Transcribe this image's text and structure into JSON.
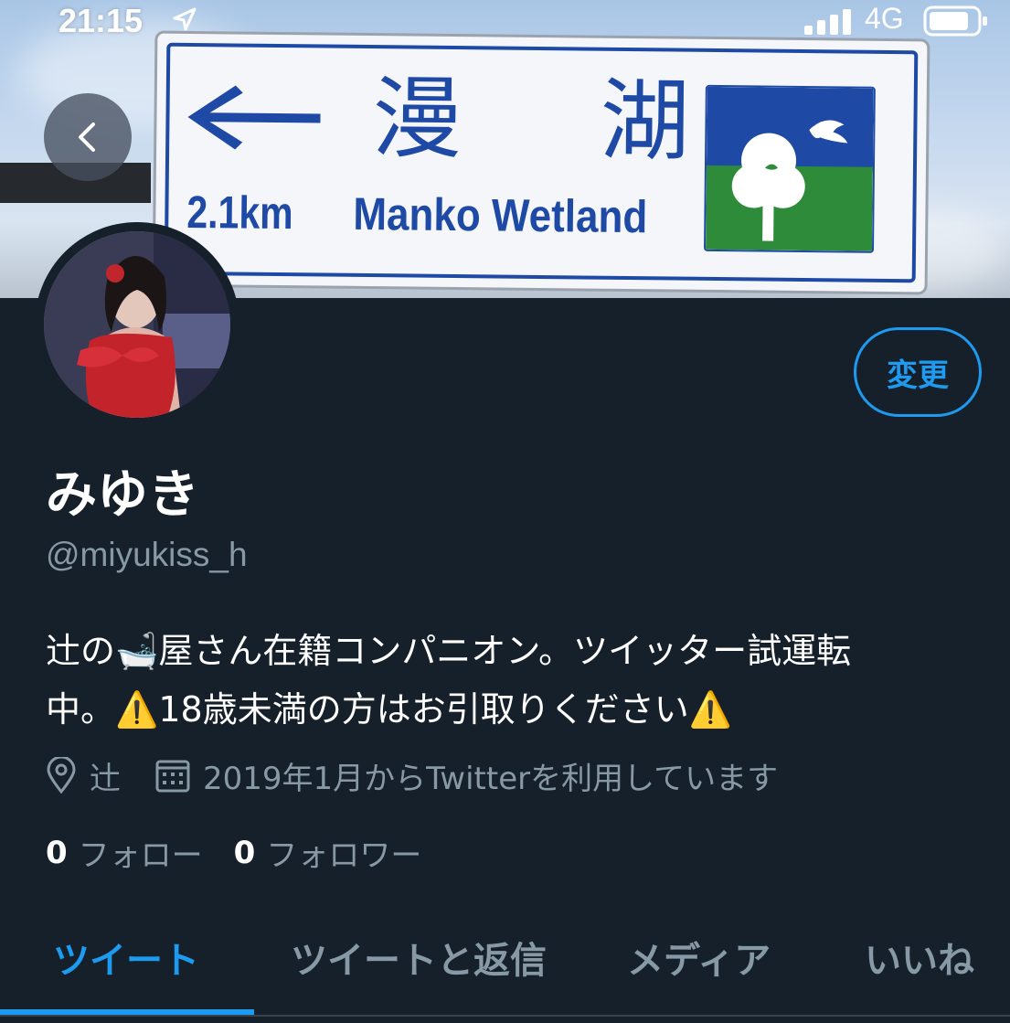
{
  "status_bar": {
    "time": "21:15",
    "network": "4G"
  },
  "banner_sign": {
    "kanji": "漫 湖",
    "distance": "2.1km",
    "name": "Manko Wetland"
  },
  "profile": {
    "display_name": "みゆき",
    "handle": "@miyukiss_h",
    "edit_label": "変更",
    "bio_line1_pre": "辻の",
    "bio_line1_emoji": "🛁",
    "bio_line1_post": "屋さん在籍コンパニオン。ツイッター試運転",
    "bio_line2_pre": "中。",
    "bio_warning_emoji": "⚠️",
    "bio_line2_mid": "18歳未満の方はお引取りください",
    "location": "辻",
    "joined": "2019年1月からTwitterを利用しています"
  },
  "counts": {
    "following_count": "0",
    "following_label": "フォロー",
    "followers_count": "0",
    "followers_label": "フォロワー"
  },
  "tabs": [
    {
      "label": "ツイート",
      "active": true
    },
    {
      "label": "ツイートと返信",
      "active": false
    },
    {
      "label": "メディア",
      "active": false
    },
    {
      "label": "いいね",
      "active": false
    }
  ],
  "colors": {
    "background": "#15202b",
    "accent": "#1d9bf0",
    "secondary_text": "#8899a6",
    "sign_blue": "#1e4aa6",
    "sign_green": "#2e8b3a"
  },
  "icons": [
    "location-arrow-icon",
    "signal-icon",
    "battery-icon",
    "back-chevron-icon",
    "location-pin-icon",
    "calendar-icon",
    "arrow-left-icon",
    "tree-bird-logo-icon"
  ]
}
